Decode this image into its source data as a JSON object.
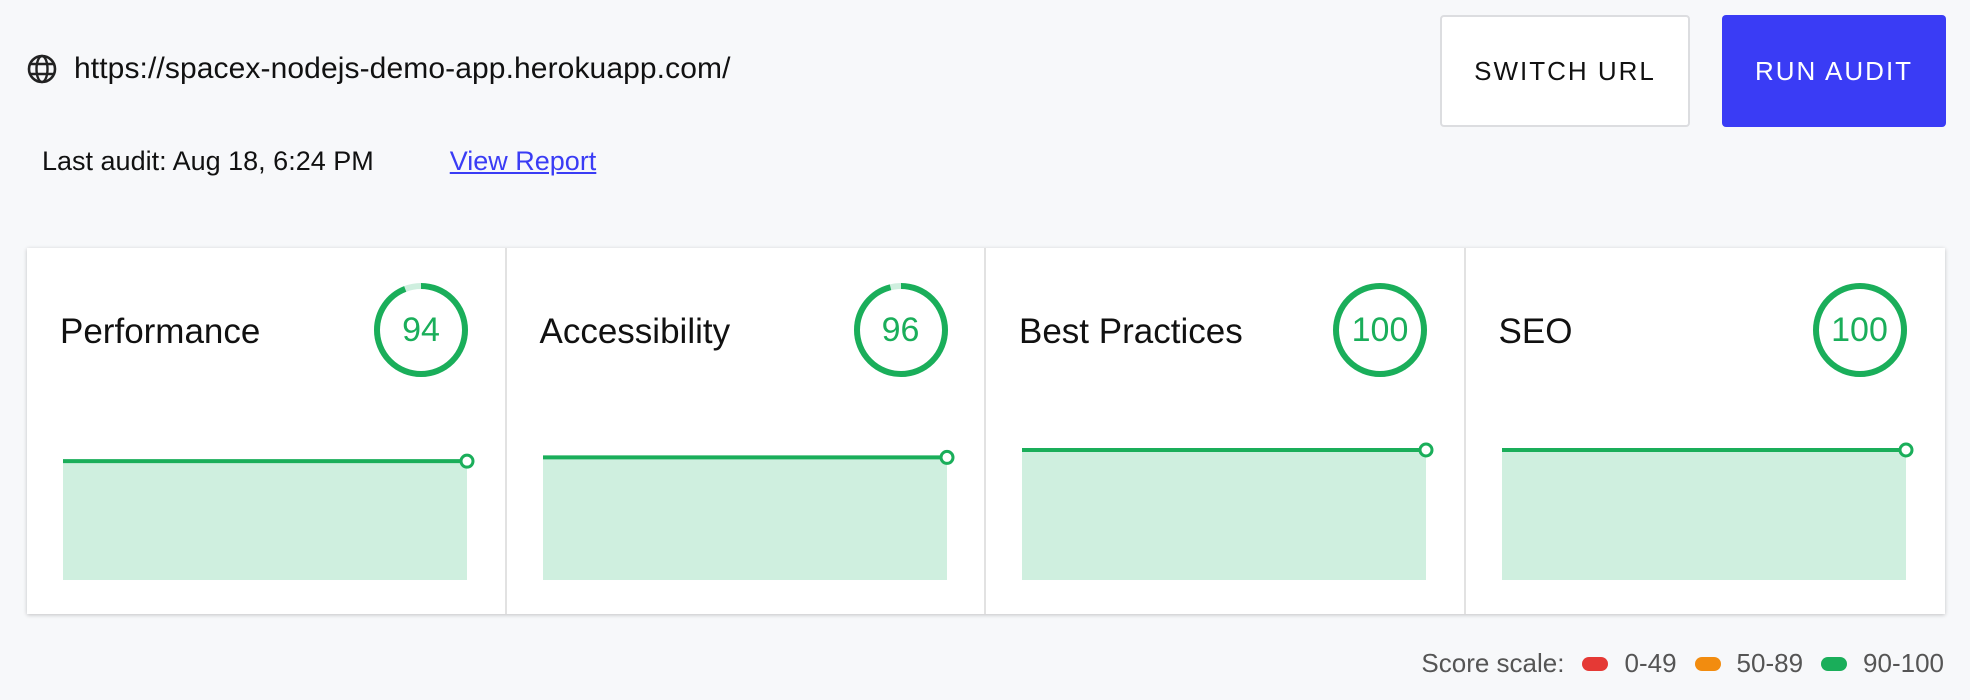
{
  "header": {
    "url": "https://spacex-nodejs-demo-app.herokuapp.com/",
    "switch_label": "SWITCH URL",
    "run_label": "RUN AUDIT",
    "last_audit": "Last audit: Aug 18, 6:24 PM",
    "view_report": "View Report"
  },
  "cards": [
    {
      "title": "Performance",
      "score": 94,
      "trend": [
        94,
        94
      ]
    },
    {
      "title": "Accessibility",
      "score": 96,
      "trend": [
        96,
        96
      ]
    },
    {
      "title": "Best Practices",
      "score": 100,
      "trend": [
        100,
        100
      ]
    },
    {
      "title": "SEO",
      "score": 100,
      "trend": [
        100,
        100
      ]
    }
  ],
  "legend": {
    "label": "Score scale:",
    "ranges": [
      {
        "label": "0-49",
        "color": "#e53935"
      },
      {
        "label": "50-89",
        "color": "#f28c0f"
      },
      {
        "label": "90-100",
        "color": "#1aae5a"
      }
    ]
  },
  "colors": {
    "accent": "#3a3cf5",
    "good": "#1aae5a",
    "good_fill": "#cfefdf"
  }
}
